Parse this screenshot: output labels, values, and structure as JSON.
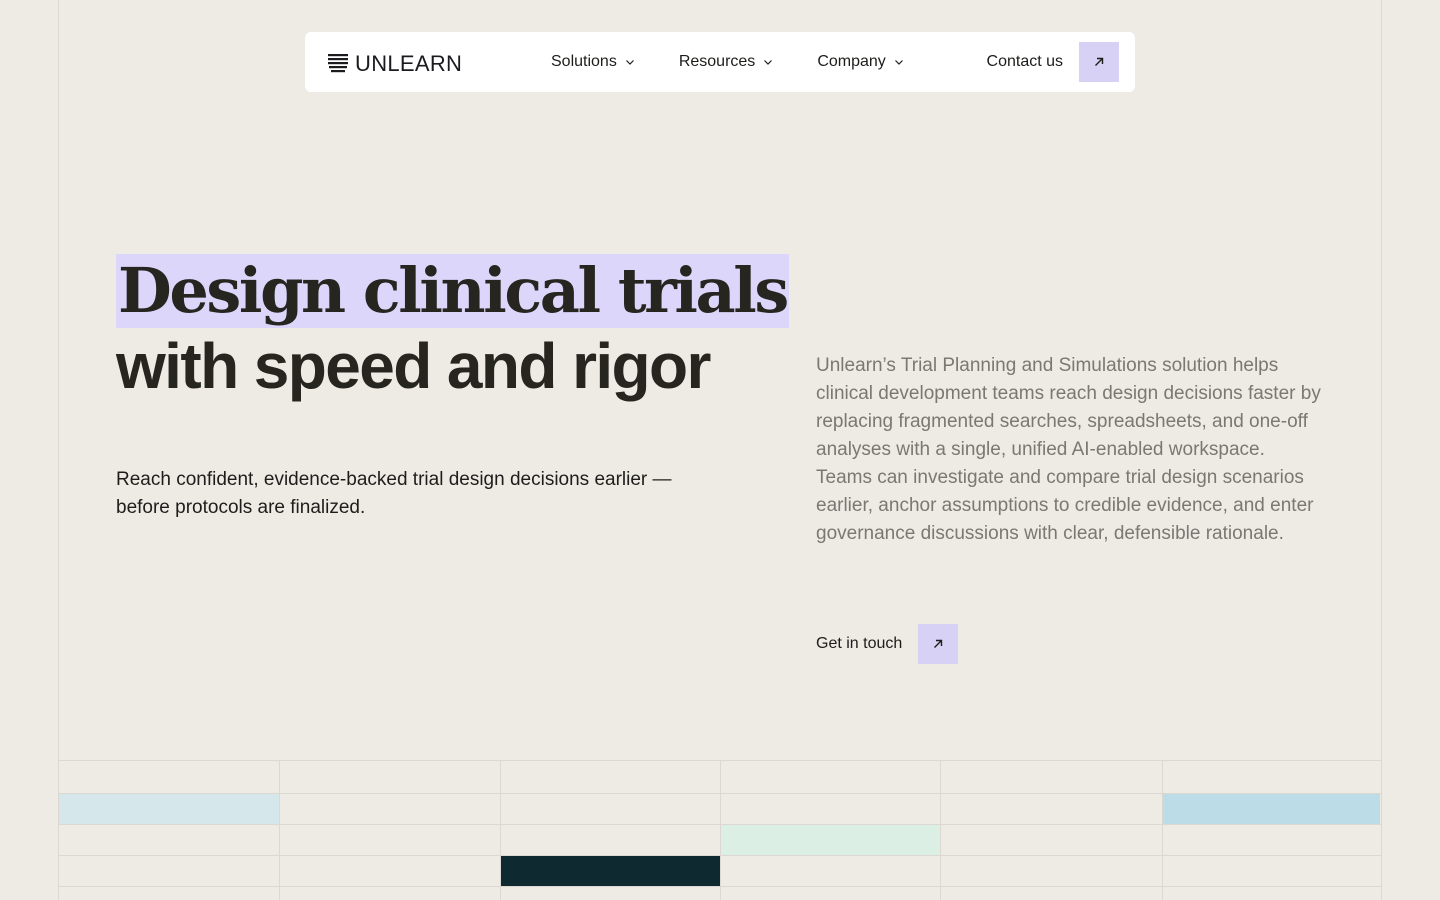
{
  "nav": {
    "logo_text": "UNLEARN",
    "items": [
      {
        "label": "Solutions"
      },
      {
        "label": "Resources"
      },
      {
        "label": "Company"
      }
    ],
    "contact_label": "Contact us"
  },
  "hero": {
    "title_highlight": "Design clinical trials",
    "title_rest": "with speed and rigor",
    "subtitle": "Reach confident, evidence-backed trial design decisions earlier — before protocols are finalized.",
    "description": "Unlearn’s Trial Planning and Simulations solution helps clinical development teams reach design decisions faster by replacing fragmented searches, spreadsheets, and one-off analyses with a single, unified AI-enabled workspace. Teams can investigate and compare trial design scenarios earlier, anchor assumptions to credible evidence, and enter governance discussions with clear, defensible rationale.",
    "cta_label": "Get in touch"
  },
  "colors": {
    "background": "#eeebe5",
    "accent_lavender": "#d6d1f5",
    "highlight": "#dcd7fa",
    "grid_line": "#dcd8d1",
    "cell_light_blue": "#d6e7ec",
    "cell_blue": "#bcdde8",
    "cell_mint": "#dcefe4",
    "cell_dark": "#0f2930"
  },
  "icons": {
    "arrow": "arrow-up-right-icon",
    "chevron": "chevron-down-icon",
    "logo": "unlearn-logo-icon"
  }
}
